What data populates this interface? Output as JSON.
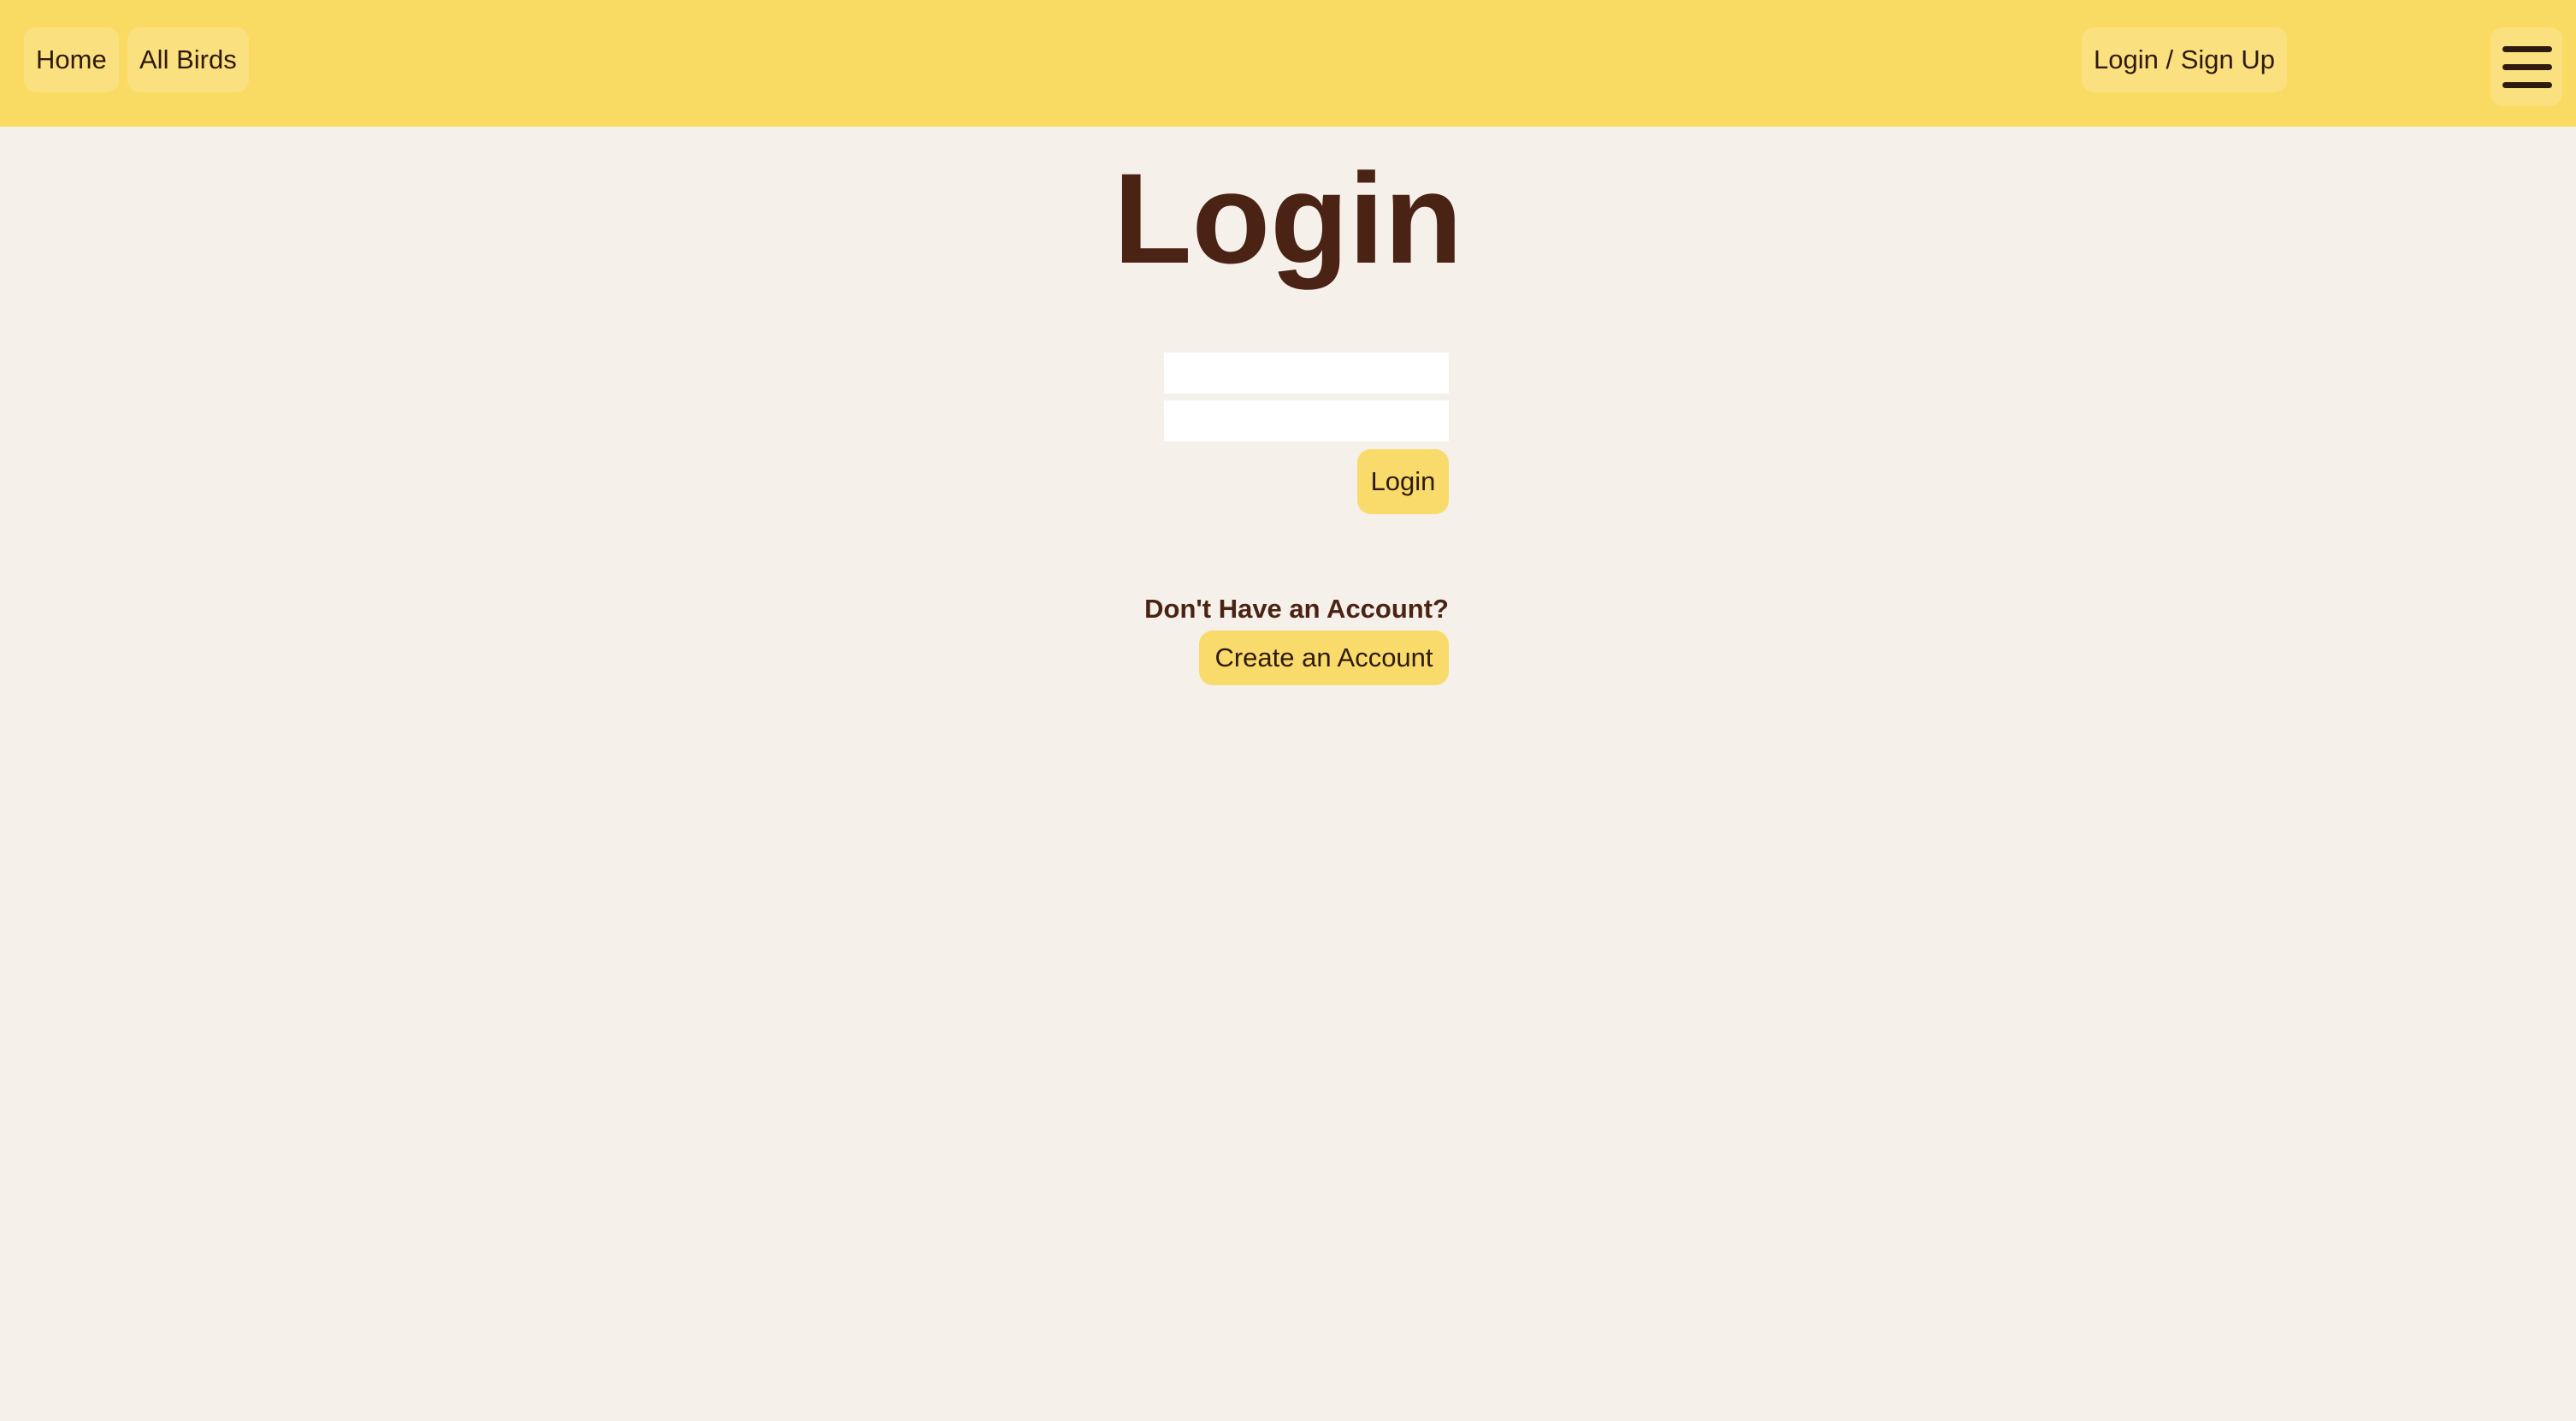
{
  "nav": {
    "home": "Home",
    "all_birds": "All Birds",
    "login_signup": "Login / Sign Up",
    "menu_icon": "hamburger-menu-icon"
  },
  "login": {
    "title": "Login",
    "username_value": "",
    "password_value": "",
    "login_button": "Login"
  },
  "signup_prompt": {
    "text": "Don't Have an Account?",
    "button": "Create an Account"
  },
  "colors": {
    "navbar": "#f9db63",
    "background": "#f5f0ea",
    "text": "#4a2314",
    "button": "#f9db6b"
  }
}
